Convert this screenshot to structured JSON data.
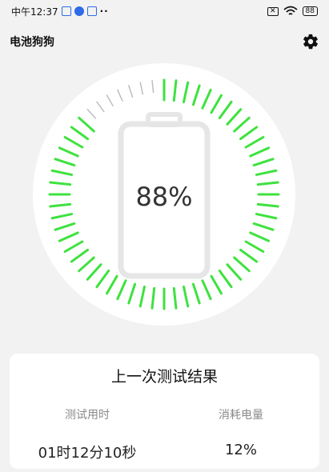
{
  "status_bar": {
    "time": "中午12:37",
    "battery_level": "88",
    "icons": [
      "sim-icon",
      "app-circle-icon",
      "app-square-icon",
      "more-dots-icon",
      "no-sim-icon",
      "wifi-icon",
      "battery-icon"
    ]
  },
  "app": {
    "title": "电池狗狗",
    "settings_icon": "gear-icon"
  },
  "dial": {
    "percent_text": "88%",
    "level": 0.88,
    "tick_count": 60,
    "active_color": "#3ee23e",
    "inactive_color": "#bdbdbd"
  },
  "result_card": {
    "title": "上一次测试结果",
    "columns": [
      {
        "label": "测试用时",
        "value": "01时12分10秒"
      },
      {
        "label": "消耗电量",
        "value": "12%"
      }
    ]
  }
}
